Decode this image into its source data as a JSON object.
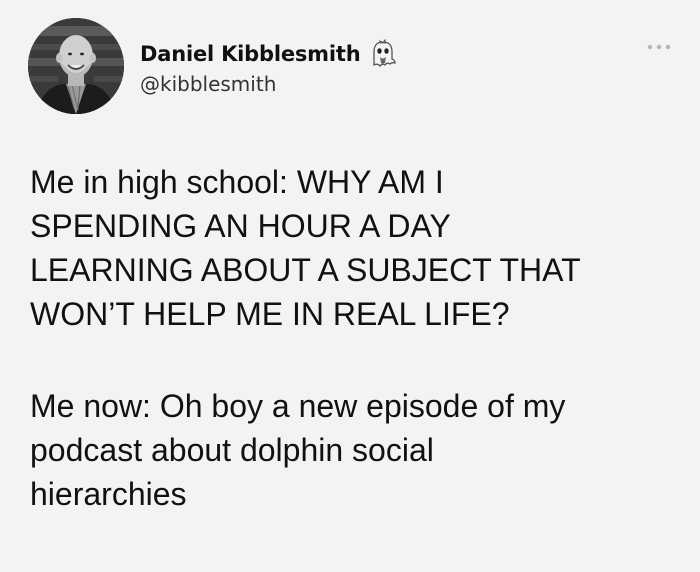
{
  "tweet": {
    "author": {
      "display_name": "Daniel Kibblesmith",
      "handle": "@kibblesmith",
      "avatar_icon": "avatar-photo",
      "badge_icon": "ghost-emoji-icon"
    },
    "menu_icon": "more-icon",
    "paragraphs": [
      {
        "lines": [
          "Me in high school: WHY AM I",
          "SPENDING AN HOUR A DAY",
          "LEARNING ABOUT A SUBJECT THAT",
          "WON’T HELP ME IN REAL LIFE?"
        ]
      },
      {
        "lines": [
          "Me now: Oh boy a new episode of my",
          "podcast about dolphin social",
          "hierarchies"
        ]
      }
    ]
  }
}
